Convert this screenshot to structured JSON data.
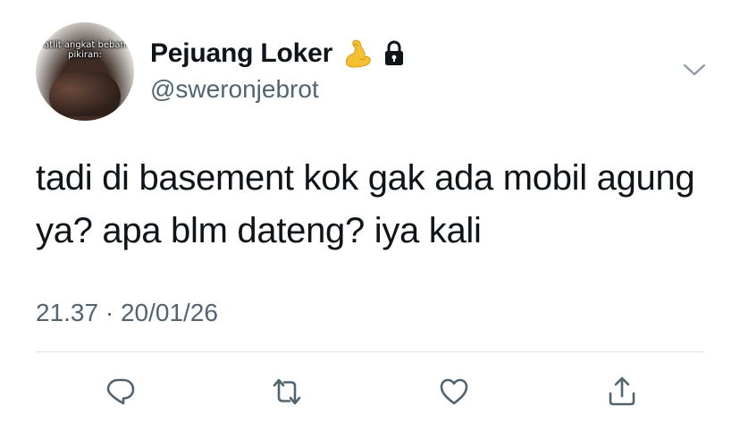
{
  "tweet": {
    "avatar_caption": "atlit angkat beban pikiran:",
    "display_name": "Pejuang Loker",
    "badge_emoji_icon": "flexed-biceps-icon",
    "protected_icon": "lock-icon",
    "handle": "@sweronjebrot",
    "text": "tadi di basement kok gak ada mobil agung ya? apa blm dateng? iya kali",
    "time": "21.37",
    "separator": "·",
    "date": "20/01/26",
    "more_icon": "chevron-down-icon"
  },
  "actions": [
    {
      "name": "reply",
      "icon": "reply-icon"
    },
    {
      "name": "retweet",
      "icon": "retweet-icon"
    },
    {
      "name": "like",
      "icon": "heart-icon"
    },
    {
      "name": "share",
      "icon": "share-icon"
    }
  ],
  "colors": {
    "text": "#0f1419",
    "secondary": "#536471",
    "divider": "#d8dde1",
    "icon": "#536471"
  }
}
